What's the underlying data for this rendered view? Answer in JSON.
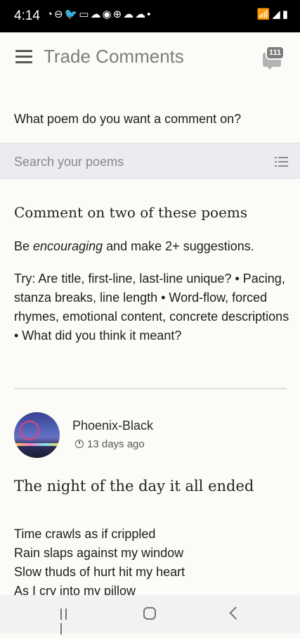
{
  "status_bar": {
    "time": "4:14",
    "notification_icons": "◔⊖🐦▭☁◉⊕☁☁•",
    "system_icons": "📶◢▮"
  },
  "app_bar": {
    "title": "Trade Comments",
    "comments_badge": "111"
  },
  "question": "What poem do you want a comment on?",
  "search": {
    "placeholder": "Search your poems"
  },
  "instructions": {
    "title": "Comment on two of these poems",
    "line_prefix": "Be ",
    "line_emphasis": "encouraging",
    "line_suffix": " and make 2+ suggestions.",
    "tips": "Try: Are title, first-line, last-line unique? • Pacing, stanza breaks, line length • Word-flow, forced rhymes, emotional content, concrete descriptions • What did you think it meant?"
  },
  "post": {
    "author": "Phoenix-Black",
    "time_ago": "13 days ago",
    "title": "The night of the day it all ended",
    "lines": [
      "Time crawls as if crippled",
      "Rain slaps against my window",
      "Slow thuds of hurt hit my heart",
      "As I cry into my pillow"
    ]
  },
  "icons": {
    "menu": "menu-icon",
    "comments": "comments-icon",
    "filter": "list-icon",
    "clock": "clock-icon"
  }
}
